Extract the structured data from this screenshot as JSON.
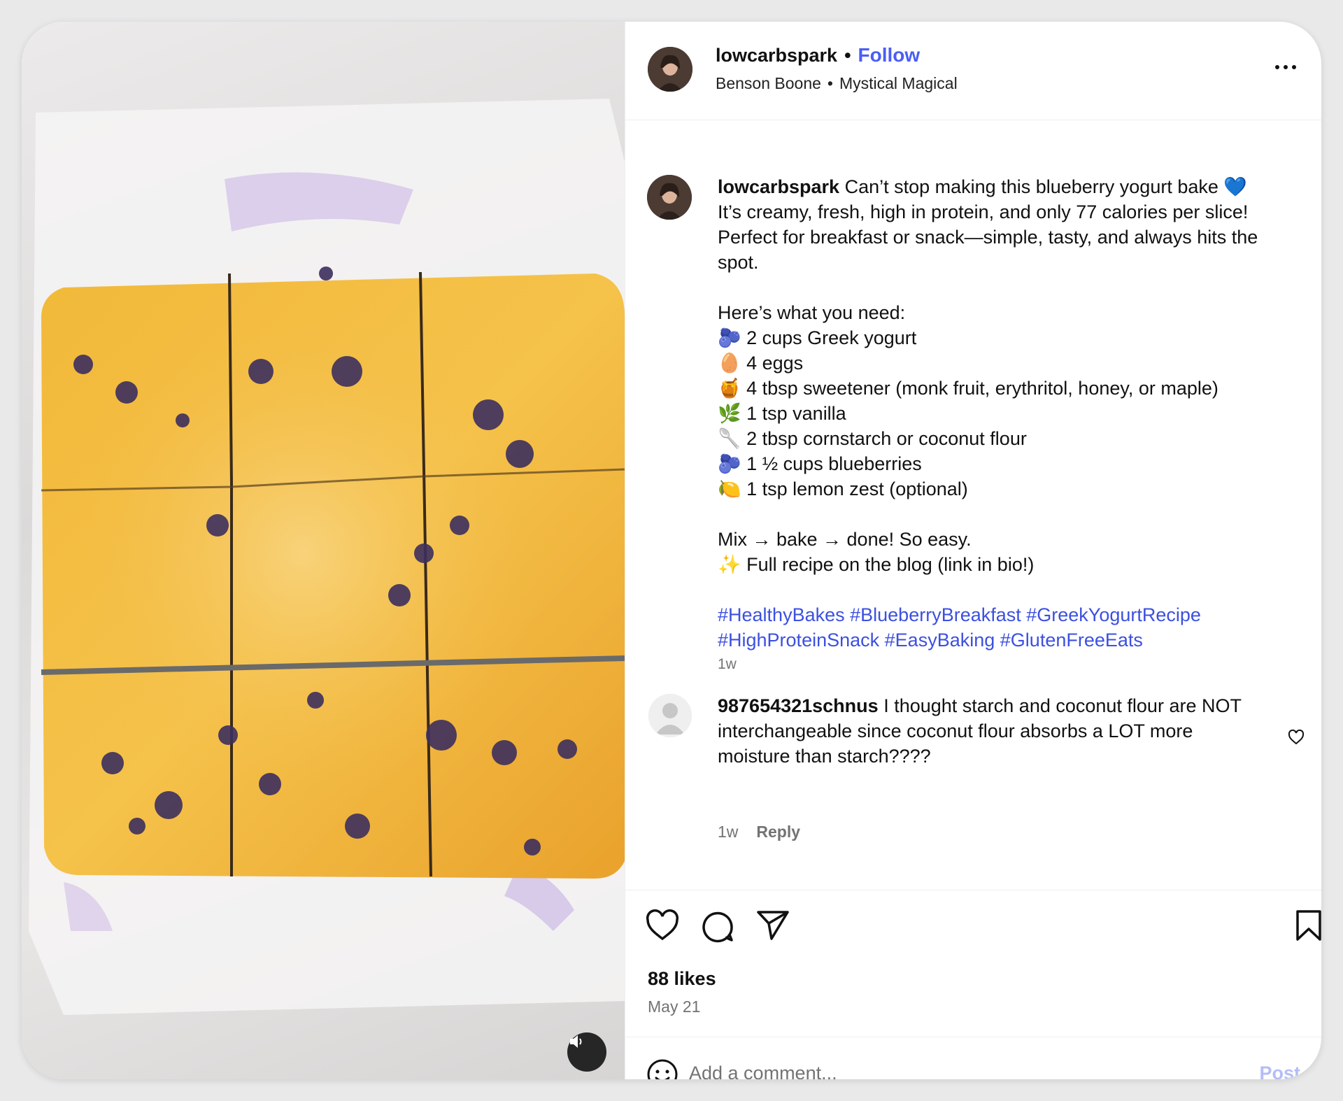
{
  "post": {
    "media_alt": "blueberry yogurt bake",
    "author": {
      "username": "lowcarbspark",
      "follow_label": "Follow",
      "separator": "•"
    },
    "audio": {
      "artist": "Benson Boone",
      "separator": "•",
      "song": "Mystical Magical"
    }
  },
  "caption": {
    "username": "lowcarbspark",
    "lines": [
      "Can’t stop making this blueberry yogurt bake 💙",
      "It’s creamy, fresh, high in protein, and only 77 calories per slice!",
      "Perfect for breakfast or snack—simple, tasty, and always hits the spot."
    ],
    "need_heading": "Here’s what you need:",
    "ingredients": [
      "🫐 2 cups Greek yogurt",
      "🥚 4 eggs",
      "🍯 4 tbsp sweetener (monk fruit, erythritol, honey, or maple)",
      "🌿 1 tsp vanilla",
      "🥄 2 tbsp cornstarch or coconut flour",
      "🫐 1 ½ cups blueberries",
      "🍋 1 tsp lemon zest (optional)"
    ],
    "outro": [
      "Mix → bake → done! So easy.",
      "✨ Full recipe on the blog (link in bio!)"
    ],
    "hashtags": [
      "#HealthyBakes",
      "#BlueberryBreakfast",
      "#GreekYogurtRecipe",
      "#HighProteinSnack",
      "#EasyBaking",
      "#GlutenFreeEats"
    ],
    "time": "1w"
  },
  "comment": {
    "username": "987654321schnus",
    "text": "I thought starch and coconut flour are NOT interchangeable since coconut flour absorbs a LOT more moisture than starch????",
    "time": "1w",
    "reply_label": "Reply"
  },
  "footer": {
    "likes": "88 likes",
    "date": "May 21",
    "comment_placeholder": "Add a comment...",
    "post_label": "Post"
  },
  "colors": {
    "accent": "#4a5df5",
    "hashtag": "#3c50e0",
    "muted": "#737373",
    "post_disabled": "#b5bdf7"
  }
}
